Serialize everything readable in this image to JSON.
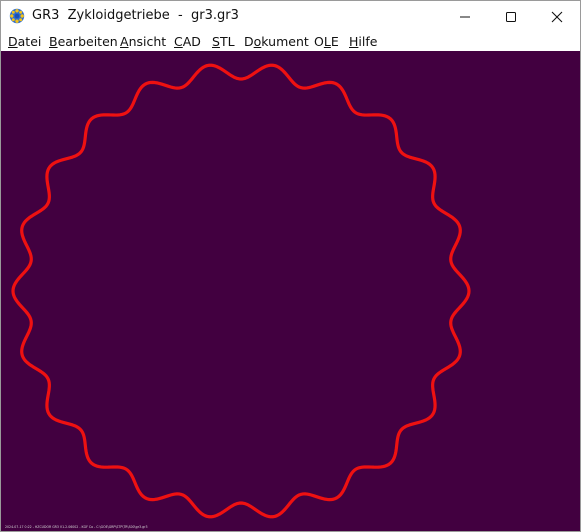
{
  "window": {
    "title_app": "GR3",
    "title_module": "Zykloidgetriebe",
    "title_separator": "-",
    "title_file": "gr3.gr3",
    "app_icon": "gear-flower-icon"
  },
  "caption_buttons": {
    "minimize_icon": "minimize-icon",
    "maximize_icon": "maximize-icon",
    "close_icon": "close-icon"
  },
  "menubar": {
    "items": [
      {
        "mnemonic": "D",
        "rest": "atei"
      },
      {
        "mnemonic": "B",
        "rest": "earbeiten"
      },
      {
        "mnemonic": "A",
        "rest": "nsicht"
      },
      {
        "mnemonic": "C",
        "rest": "AD"
      },
      {
        "mnemonic": "S",
        "rest": "TL"
      },
      {
        "lead": "D",
        "mnemonic": "o",
        "rest": "kument"
      },
      {
        "lead": "O",
        "mnemonic": "L",
        "rest": "E"
      },
      {
        "mnemonic": "H",
        "rest": "ilfe"
      }
    ]
  },
  "canvas": {
    "background": "#420040",
    "curve_color": "#ee1111",
    "shape": "epicycloid-outline",
    "lobe_count": 22,
    "footer_text": "2024-07-17 0:22 - HZCUDOR GR3 V1.2.06002 - KGF Co - C:\\GOE\\GRP\\STP\\TR\\S00\\gr3.gr3"
  }
}
